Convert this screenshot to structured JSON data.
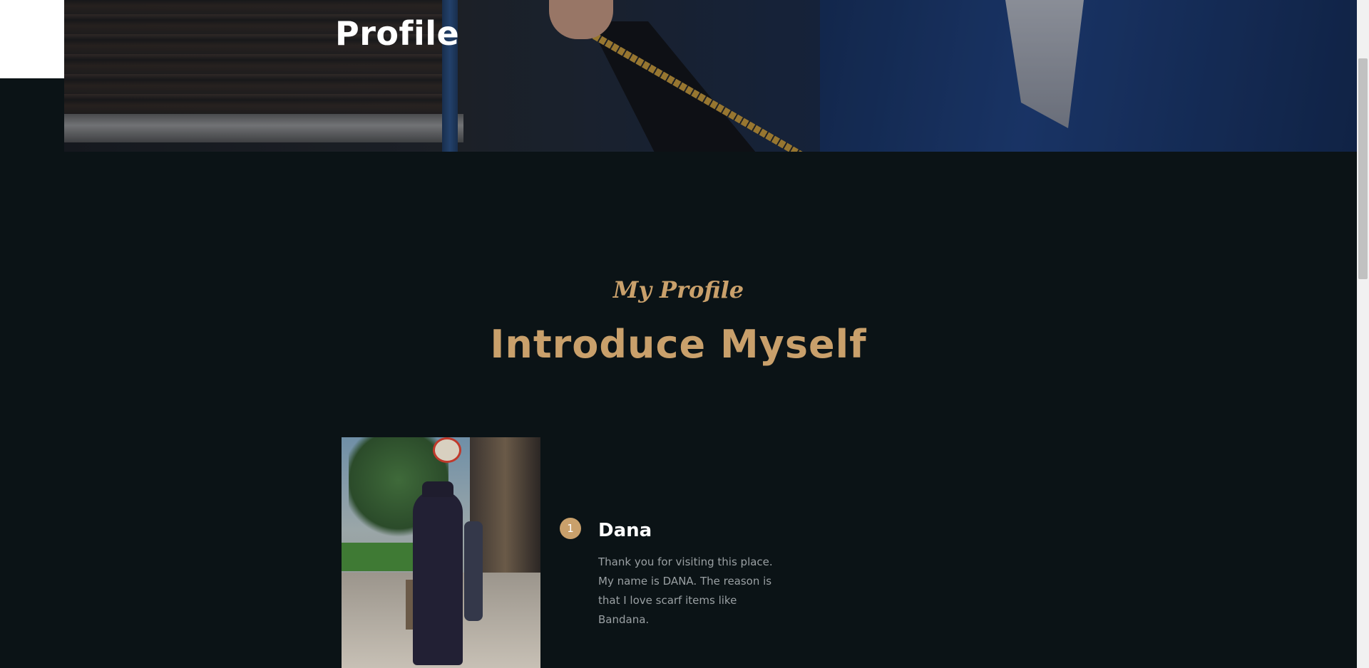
{
  "hero": {
    "title": "Profile"
  },
  "intro": {
    "subtitle": "My Profile",
    "title": "Introduce Myself"
  },
  "profile": {
    "step_number": "1",
    "name": "Dana",
    "description": "Thank you for visiting this place. My name is DANA. The reason is that I love scarf items like Bandana."
  },
  "colors": {
    "background": "#0b1316",
    "accent": "#c9a06b",
    "text_muted": "#9aa0a3"
  }
}
